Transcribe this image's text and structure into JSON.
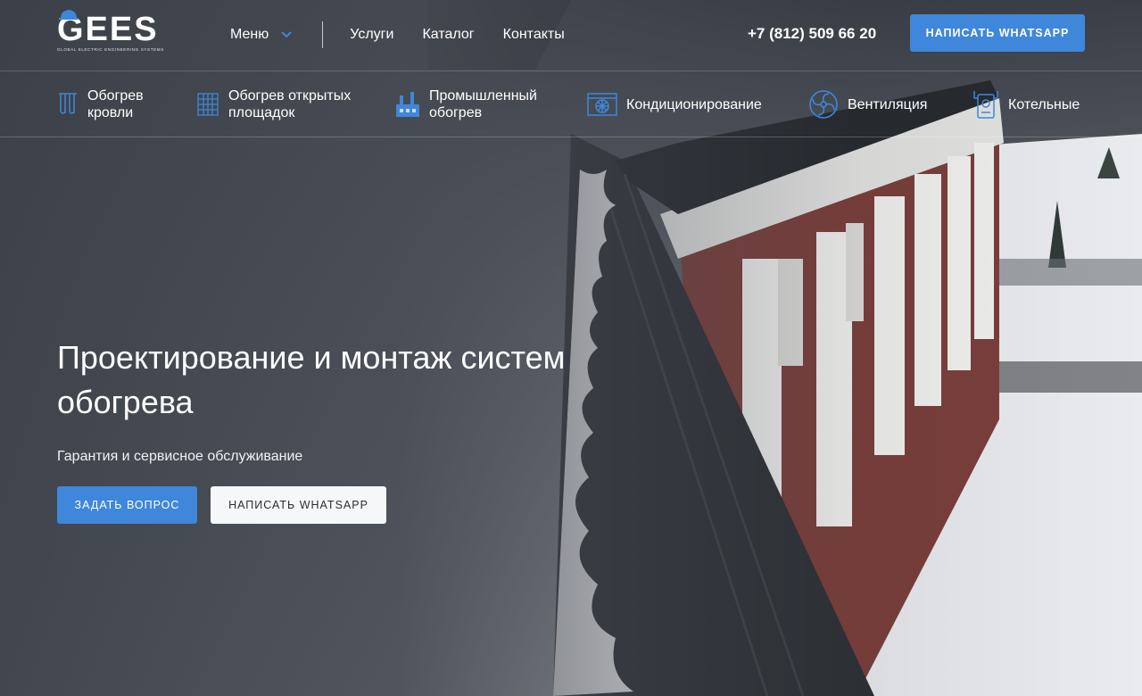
{
  "logo": {
    "name": "GEES",
    "tagline": "GLOBAL ELECTRIC ENGINEERING SYSTEMS"
  },
  "nav": {
    "menu_label": "Меню",
    "links": [
      "Услуги",
      "Каталог",
      "Контакты"
    ]
  },
  "phone": "+7 (812) 509 66 20",
  "whatsapp_top_label": "НАПИСАТЬ WHATSAPP",
  "categories": [
    {
      "label_line1": "Обогрев",
      "label_line2": "кровли",
      "icon": "roof-heating-icon"
    },
    {
      "label_line1": "Обогрев открытых",
      "label_line2": "площадок",
      "icon": "open-area-heating-icon"
    },
    {
      "label_line1": "Промышленный",
      "label_line2": "обогрев",
      "icon": "industrial-heating-icon"
    },
    {
      "label_line1": "Кондиционирование",
      "label_line2": "",
      "icon": "air-conditioning-icon"
    },
    {
      "label_line1": "Вентиляция",
      "label_line2": "",
      "icon": "ventilation-icon"
    },
    {
      "label_line1": "Котельные",
      "label_line2": "",
      "icon": "boiler-icon"
    }
  ],
  "hero": {
    "title": "Проектирование и монтаж систем обогрева",
    "subtitle": "Гарантия и сервисное обслуживание",
    "ask_button": "ЗАДАТЬ ВОПРОС",
    "whatsapp_button": "НАПИСАТЬ WHATSAPP"
  },
  "colors": {
    "accent": "#3f87da",
    "icon_blue": "#3f87da",
    "light_button": "#f6f7f9"
  }
}
